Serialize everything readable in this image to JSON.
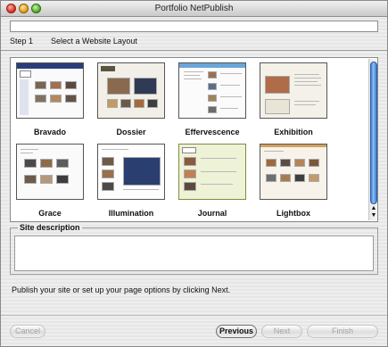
{
  "window": {
    "title": "Portfolio NetPublish"
  },
  "step": {
    "number": "Step 1",
    "title": "Select a Website Layout"
  },
  "layouts": [
    {
      "name": "Bravado"
    },
    {
      "name": "Dossier"
    },
    {
      "name": "Effervescence"
    },
    {
      "name": "Exhibition"
    },
    {
      "name": "Grace"
    },
    {
      "name": "Illumination"
    },
    {
      "name": "Journal"
    },
    {
      "name": "Lightbox"
    }
  ],
  "site_description": {
    "label": "Site description",
    "value": ""
  },
  "hint": "Publish your site or set up your page options by clicking Next.",
  "buttons": {
    "cancel": "Cancel",
    "previous": "Previous",
    "next": "Next",
    "finish": "Finish"
  },
  "colors": {
    "scroll_accent": "#5a9be6"
  }
}
